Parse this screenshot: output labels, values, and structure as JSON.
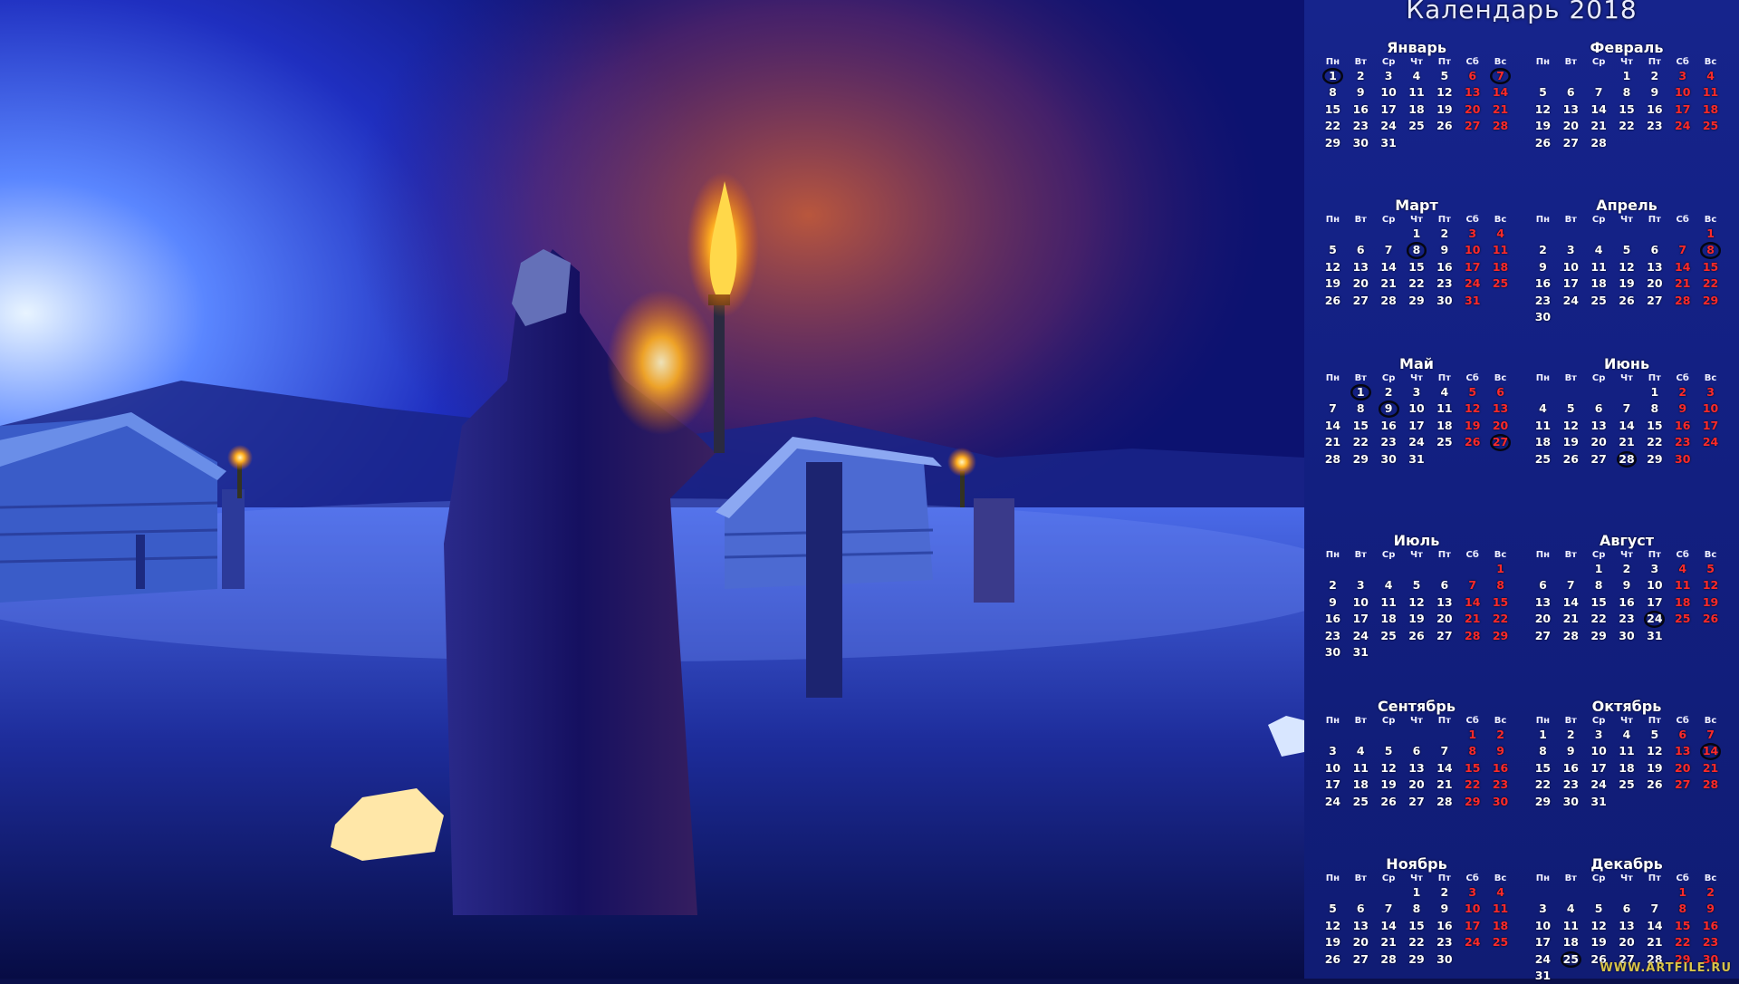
{
  "calendar": {
    "title": "Календарь 2018",
    "weekday_labels": [
      "Пн",
      "Вт",
      "Ср",
      "Чт",
      "Пт",
      "Сб",
      "Вс"
    ],
    "watermark": "WWW.ARTFILE.RU",
    "colors": {
      "panel_bg": "#121f80",
      "weekend": "#ff2a2a",
      "weekday": "#ffffff",
      "highlight_ring": "#050612"
    },
    "months": [
      {
        "name": "Январь",
        "start": 0,
        "days": 31,
        "highlighted": [
          1,
          7
        ]
      },
      {
        "name": "Февраль",
        "start": 3,
        "days": 28,
        "highlighted": []
      },
      {
        "name": "Март",
        "start": 3,
        "days": 31,
        "highlighted": [
          8
        ]
      },
      {
        "name": "Апрель",
        "start": 6,
        "days": 30,
        "highlighted": [
          8
        ]
      },
      {
        "name": "Май",
        "start": 1,
        "days": 31,
        "highlighted": [
          1,
          9,
          27
        ]
      },
      {
        "name": "Июнь",
        "start": 4,
        "days": 30,
        "highlighted": [
          28
        ]
      },
      {
        "name": "Июль",
        "start": 6,
        "days": 31,
        "highlighted": []
      },
      {
        "name": "Август",
        "start": 2,
        "days": 31,
        "highlighted": [
          24
        ]
      },
      {
        "name": "Сентябрь",
        "start": 5,
        "days": 30,
        "highlighted": []
      },
      {
        "name": "Октябрь",
        "start": 0,
        "days": 31,
        "highlighted": [
          14
        ]
      },
      {
        "name": "Ноябрь",
        "start": 3,
        "days": 30,
        "highlighted": []
      },
      {
        "name": "Декабрь",
        "start": 5,
        "days": 31,
        "highlighted": [
          25
        ]
      }
    ]
  },
  "scene": {
    "icons": [
      "hooded-figure-icon",
      "torch-icon",
      "log-hut-icon",
      "stone-idol-icon",
      "glowing-rock-icon",
      "mountains-icon"
    ]
  }
}
